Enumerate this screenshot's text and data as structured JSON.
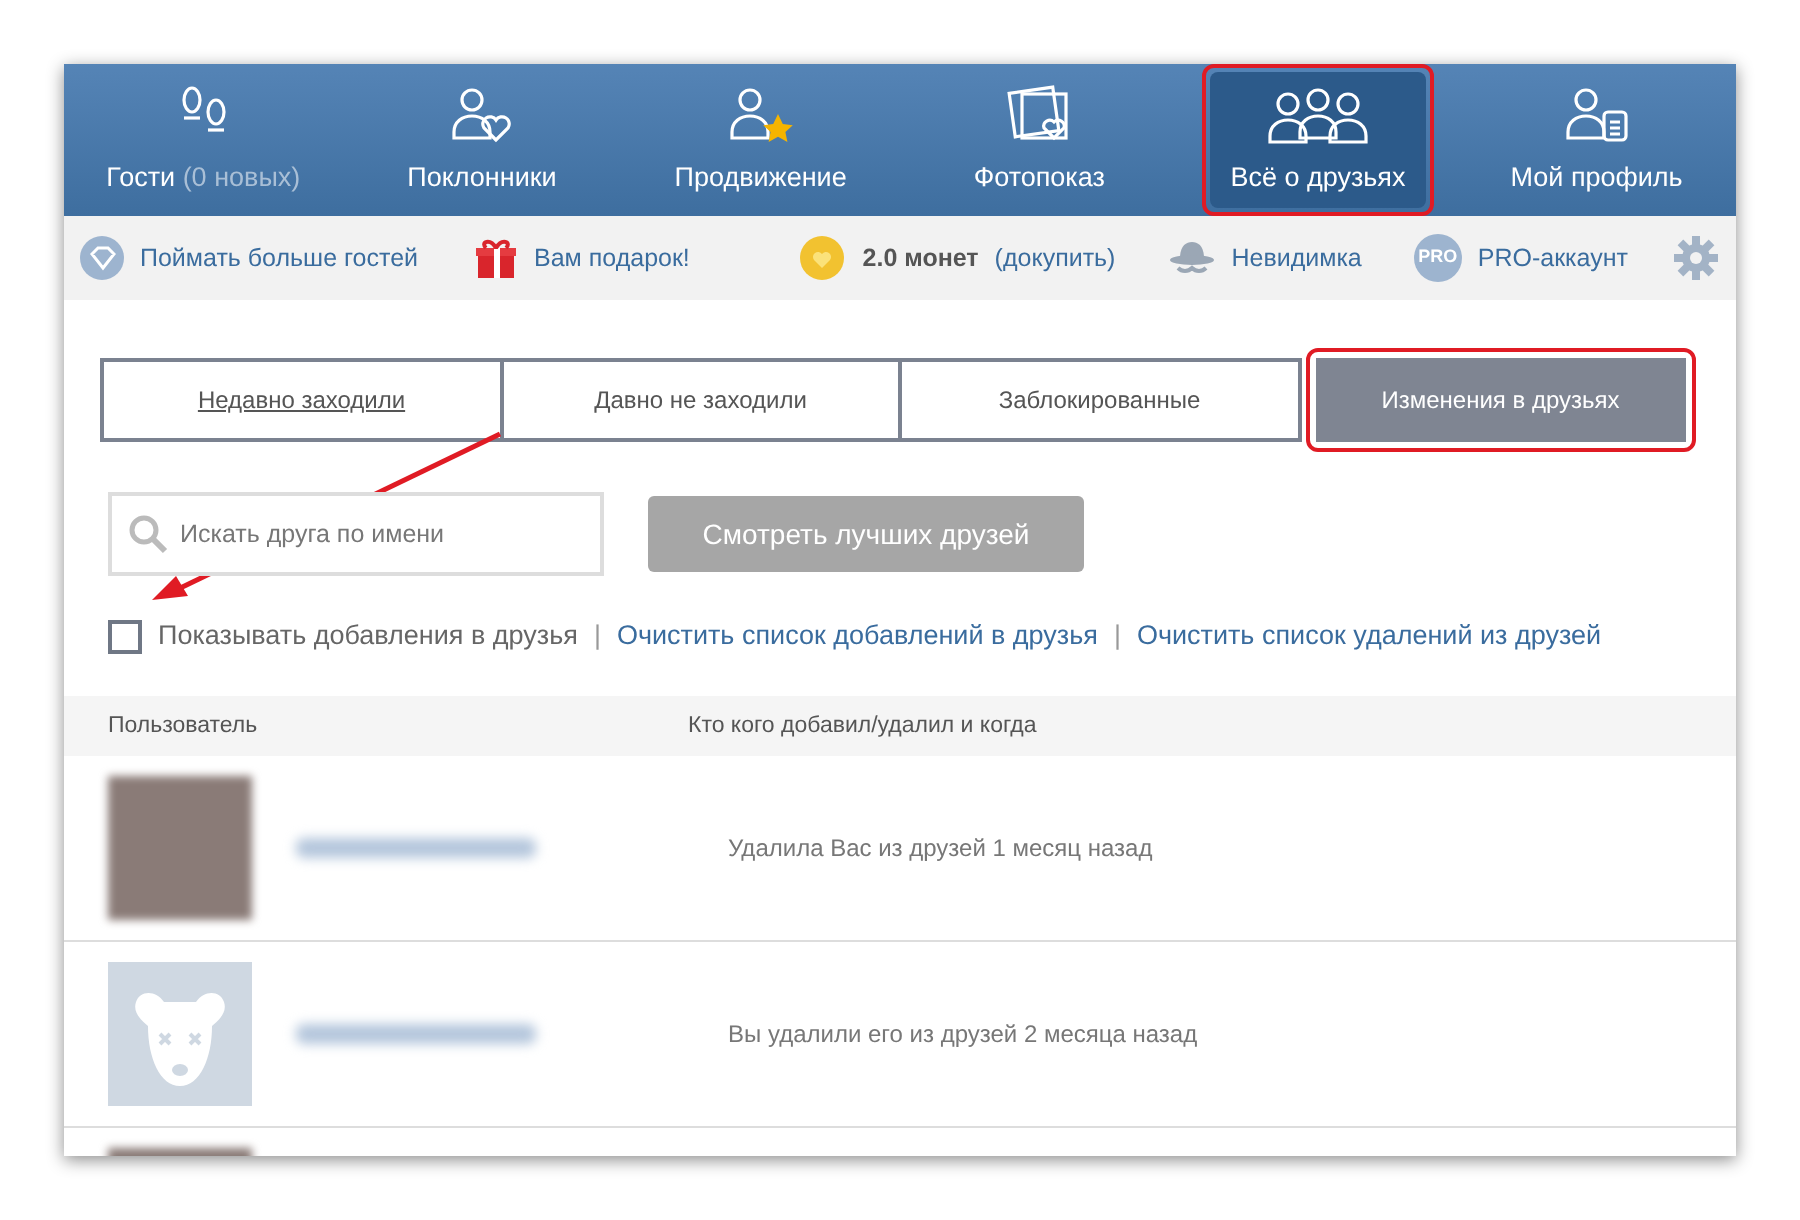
{
  "nav_tabs": [
    {
      "label": "Гости",
      "sublabel": "(0 новых)",
      "selected": false,
      "highlighted": false
    },
    {
      "label": "Поклонники",
      "selected": false,
      "highlighted": false
    },
    {
      "label": "Продвижение",
      "selected": false,
      "highlighted": false
    },
    {
      "label": "Фотопоказ",
      "selected": false,
      "highlighted": false
    },
    {
      "label": "Всё о друзьях",
      "selected": true,
      "highlighted": true
    },
    {
      "label": "Мой профиль",
      "selected": false,
      "highlighted": false
    }
  ],
  "toolbar": {
    "catch_guests": "Поймать больше гостей",
    "gift": "Вам подарок!",
    "coins_amount": "2.0 монет",
    "coins_link": "(докупить)",
    "invisible": "Невидимка",
    "pro_badge": "PRO",
    "pro": "PRO-аккаунт"
  },
  "filter_tabs": [
    {
      "label": "Недавно заходили",
      "selected": false,
      "link": true,
      "highlighted": false
    },
    {
      "label": "Давно не заходили",
      "selected": false,
      "link": false,
      "highlighted": false
    },
    {
      "label": "Заблокированные",
      "selected": false,
      "link": false,
      "highlighted": false
    },
    {
      "label": "Изменения в друзьях",
      "selected": true,
      "link": false,
      "highlighted": true
    }
  ],
  "search": {
    "placeholder": "Искать друга по имени"
  },
  "best_friends_button": "Смотреть лучших друзей",
  "show_additions": {
    "label": "Показывать добавления в друзья",
    "checked": false,
    "highlighted": true
  },
  "links": [
    {
      "separator": "|",
      "text": "Очистить список добавлений в друзья"
    },
    {
      "separator": "|",
      "text": "Очистить список удалений из друзей"
    }
  ],
  "table": {
    "columns": [
      "Пользователь",
      "Кто кого добавил/удалил и когда"
    ],
    "rows": [
      {
        "kind": "photo",
        "event": "Удалила Вас из друзей 1 месяц назад"
      },
      {
        "kind": "default",
        "event": "Вы удалили его из друзей 2 месяца назад"
      },
      {
        "kind": "photo"
      }
    ]
  }
}
